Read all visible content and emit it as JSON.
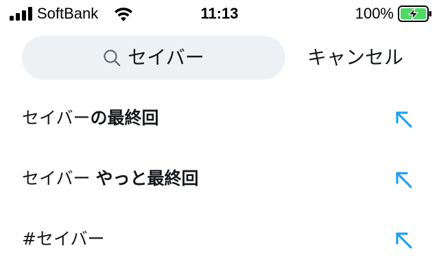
{
  "status_bar": {
    "carrier": "SoftBank",
    "time": "11:13",
    "battery_percent": "100%",
    "signal_icon": "cellular-signal-icon",
    "wifi_icon": "wifi-icon",
    "battery_icon": "battery-charging-icon",
    "battery_color": "#4cd964"
  },
  "search": {
    "icon": "search-icon",
    "query": "セイバー",
    "cancel_label": "キャンセル",
    "field_color": "#eef1f3"
  },
  "suggestions": [
    {
      "typed": "セイバー",
      "completion": "の最終回",
      "arrow_icon": "fill-query-arrow-icon"
    },
    {
      "typed": "セイバー ",
      "completion": "やっと最終回",
      "arrow_icon": "fill-query-arrow-icon"
    },
    {
      "typed": "#セイバー",
      "completion": "",
      "arrow_icon": "fill-query-arrow-icon"
    }
  ],
  "colors": {
    "accent": "#1da1f2",
    "text": "#14171a"
  }
}
